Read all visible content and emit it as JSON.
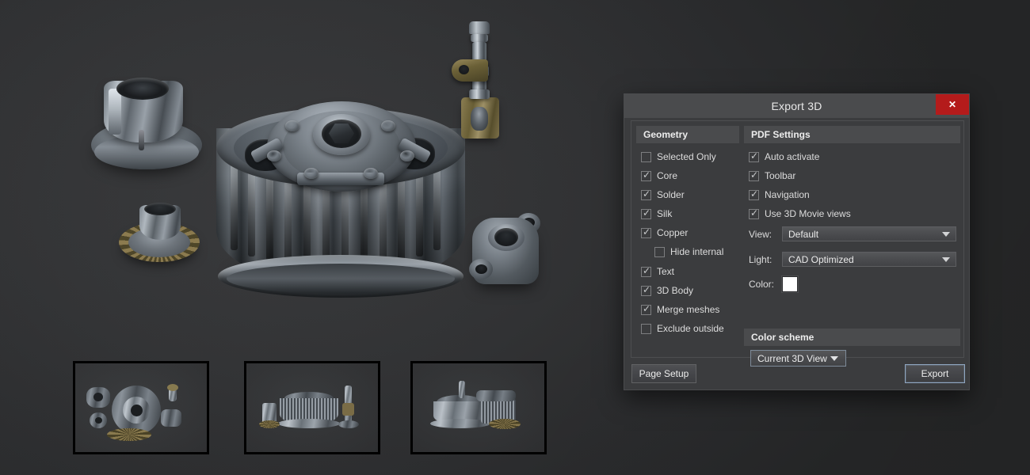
{
  "app": {
    "viewport_name": "3d-model-viewport",
    "background_color": "#2e2f31"
  },
  "dialog": {
    "title": "Export 3D",
    "close_label": "✕",
    "sections": {
      "geometry_header": "Geometry",
      "pdf_header": "PDF Settings",
      "color_scheme_header": "Color scheme"
    },
    "geometry_options": [
      {
        "label": "Selected Only",
        "checked": false,
        "indent": false
      },
      {
        "label": "Core",
        "checked": true,
        "indent": false
      },
      {
        "label": "Solder",
        "checked": true,
        "indent": false
      },
      {
        "label": "Silk",
        "checked": true,
        "indent": false
      },
      {
        "label": "Copper",
        "checked": true,
        "indent": false
      },
      {
        "label": "Hide internal",
        "checked": false,
        "indent": true
      },
      {
        "label": "Text",
        "checked": true,
        "indent": false
      },
      {
        "label": "3D Body",
        "checked": true,
        "indent": false
      },
      {
        "label": "Merge meshes",
        "checked": true,
        "indent": false
      },
      {
        "label": "Exclude outside",
        "checked": false,
        "indent": false
      }
    ],
    "pdf_options": [
      {
        "label": "Auto activate",
        "checked": true
      },
      {
        "label": "Toolbar",
        "checked": true
      },
      {
        "label": "Navigation",
        "checked": true
      },
      {
        "label": "Use 3D Movie views",
        "checked": true
      }
    ],
    "fields": {
      "view_label": "View:",
      "view_value": "Default",
      "light_label": "Light:",
      "light_value": "CAD Optimized",
      "color_label": "Color:",
      "color_value": "#ffffff"
    },
    "color_scheme_value": "Current 3D View",
    "buttons": {
      "page_setup": "Page Setup",
      "export": "Export"
    },
    "accent_close_color": "#b41b1b",
    "accent_focus_color": "#8fa6c0"
  },
  "thumbnails": [
    {
      "name": "view-1"
    },
    {
      "name": "view-2"
    },
    {
      "name": "view-3"
    }
  ]
}
